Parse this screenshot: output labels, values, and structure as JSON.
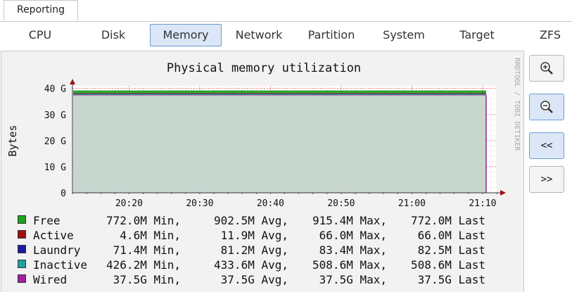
{
  "top_tab": {
    "label": "Reporting"
  },
  "subtabs": [
    "CPU",
    "Disk",
    "Memory",
    "Network",
    "Partition",
    "System",
    "Target",
    "ZFS"
  ],
  "active_subtab": "Memory",
  "chart_data": {
    "type": "area",
    "title": "Physical memory utilization",
    "ylabel": "Bytes",
    "watermark": "RRDTOOL / TOBI OETIKER",
    "y_ticks": [
      "0",
      "10 G",
      "20 G",
      "30 G",
      "40 G"
    ],
    "y_tick_values": [
      0,
      10,
      20,
      30,
      40
    ],
    "ylim": [
      0,
      41
    ],
    "x_ticks": [
      "20:20",
      "20:30",
      "20:40",
      "20:50",
      "21:00",
      "21:10"
    ],
    "x_tick_minutes": [
      1220,
      1230,
      1240,
      1250,
      1260,
      1270
    ],
    "xlim_minutes": [
      1212,
      1272
    ],
    "series": [
      {
        "name": "Wired",
        "color": "#a020a0",
        "value_gb": 37.5
      },
      {
        "name": "Inactive",
        "color": "#20a0a0",
        "value_gb": 0.51
      },
      {
        "name": "Laundry",
        "color": "#1a1aa0",
        "value_gb": 0.08
      },
      {
        "name": "Active",
        "color": "#a01010",
        "value_gb": 0.07
      },
      {
        "name": "Free",
        "color": "#20a020",
        "value_gb": 0.77
      }
    ],
    "data_end_minute": 1270.5
  },
  "legend": [
    {
      "name": "Free",
      "color": "#20a020",
      "min": "772.0M Min,",
      "avg": "902.5M Avg,",
      "max": "915.4M Max,",
      "last": "772.0M Last"
    },
    {
      "name": "Active",
      "color": "#a01010",
      "min": "4.6M Min,",
      "avg": "11.9M Avg,",
      "max": "66.0M Max,",
      "last": "66.0M Last"
    },
    {
      "name": "Laundry",
      "color": "#1a1aa0",
      "min": "71.4M Min,",
      "avg": "81.2M Avg,",
      "max": "83.4M Max,",
      "last": "82.5M Last"
    },
    {
      "name": "Inactive",
      "color": "#20a0a0",
      "min": "426.2M Min,",
      "avg": "433.6M Avg,",
      "max": "508.6M Max,",
      "last": "508.6M Last"
    },
    {
      "name": "Wired",
      "color": "#a020a0",
      "min": "37.5G Min,",
      "avg": "37.5G Avg,",
      "max": "37.5G Max,",
      "last": "37.5G Last"
    }
  ],
  "zoom_buttons": {
    "zoom_in_icon": "zoom-in-icon",
    "zoom_out_icon": "zoom-out-icon",
    "back_label": "<<",
    "forward_label": ">>"
  }
}
